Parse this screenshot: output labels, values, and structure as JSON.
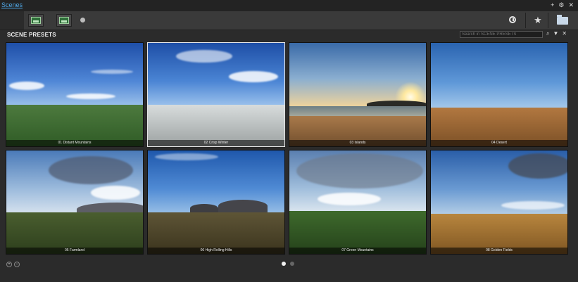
{
  "window": {
    "title": "Scenes",
    "controls": [
      "+",
      "⚙",
      "✕"
    ]
  },
  "toolbar": {
    "recent_icon": "clock-icon",
    "favorites_icon": "star-icon",
    "browse_icon": "folder-icon"
  },
  "panel": {
    "title": "SCENE PRESETS",
    "search_placeholder": "Search in SCENE PRESETS"
  },
  "presets": [
    {
      "label": "01 Distant Mountains"
    },
    {
      "label": "02 Crisp Winter"
    },
    {
      "label": "03 Islands"
    },
    {
      "label": "04 Desert"
    },
    {
      "label": "05 Farmland"
    },
    {
      "label": "06 High Rolling Hills"
    },
    {
      "label": "07 Green Mountains"
    },
    {
      "label": "08 Golden Fields"
    }
  ],
  "pagination": {
    "current_page": 1,
    "total_pages": 2
  },
  "colors": {
    "accent": "#4fa8e8",
    "background": "#2b2b2b",
    "selected_border": "#e6e6e6"
  }
}
